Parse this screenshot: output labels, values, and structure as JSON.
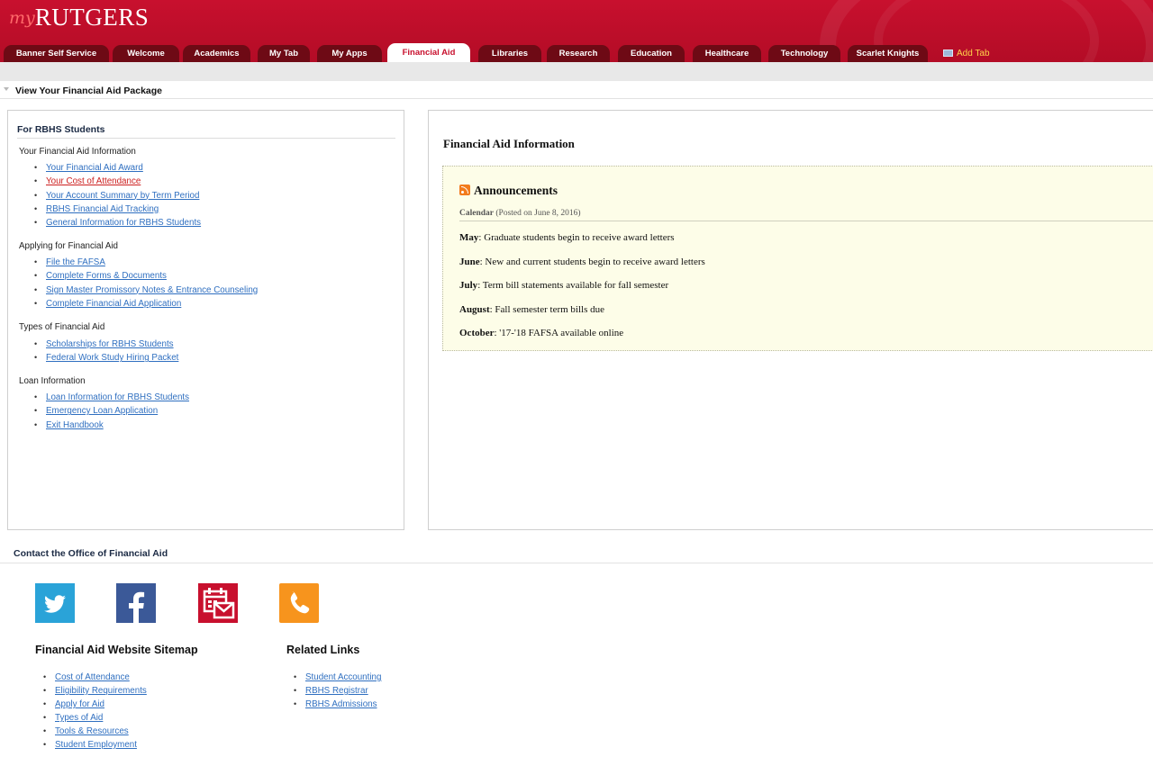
{
  "header": {
    "logo_prefix": "my",
    "logo_main": "RUTGERS",
    "tabs": [
      {
        "label": "Banner Self Service"
      },
      {
        "label": "Welcome"
      },
      {
        "label": "Academics"
      },
      {
        "label": "My Tab"
      },
      {
        "label": "My Apps"
      },
      {
        "label": "Financial Aid"
      },
      {
        "label": "Libraries"
      },
      {
        "label": "Research"
      },
      {
        "label": "Education"
      },
      {
        "label": "Healthcare"
      },
      {
        "label": "Technology"
      },
      {
        "label": "Scarlet Knights"
      }
    ],
    "active_tab": "Financial Aid",
    "add_tab_label": "Add Tab"
  },
  "package": {
    "title": "View Your Financial Aid Package"
  },
  "left_panel": {
    "title": "For RBHS Students",
    "sections": [
      {
        "heading": "Your Financial Aid Information",
        "links": [
          "Your Financial Aid Award",
          "Your Cost of Attendance",
          "Your Account Summary by Term Period",
          "RBHS Financial Aid Tracking",
          "General Information for RBHS Students"
        ]
      },
      {
        "heading": "Applying for Financial Aid",
        "links": [
          "File the FAFSA",
          "Complete Forms & Documents",
          "Sign Master Promissory Notes & Entrance Counseling",
          "Complete Financial Aid Application"
        ]
      },
      {
        "heading": "Types of Financial Aid",
        "links": [
          "Scholarships for RBHS Students",
          "Federal Work Study Hiring Packet"
        ]
      },
      {
        "heading": "Loan Information",
        "links": [
          "Loan Information for RBHS Students",
          "Emergency Loan Application",
          "Exit Handbook"
        ]
      }
    ]
  },
  "right_panel": {
    "title": "Financial Aid Information",
    "announcements": {
      "heading": "Announcements",
      "calendar_label": "Calendar",
      "posted": "(Posted on June 8, 2016)",
      "events": [
        {
          "month": "May",
          "text": ": Graduate students begin to receive award letters"
        },
        {
          "month": "June",
          "text": ": New and current students begin to receive award letters"
        },
        {
          "month": "July",
          "text": ": Term bill statements available for fall semester"
        },
        {
          "month": "August",
          "text": ": Fall semester term bills due"
        },
        {
          "month": "October",
          "text": ": '17-'18 FAFSA available online"
        }
      ]
    }
  },
  "footer": {
    "contact_title": "Contact the Office of Financial Aid",
    "social_icons": [
      "twitter-icon",
      "facebook-icon",
      "calendar-mail-icon",
      "phone-icon"
    ],
    "icon_colors": {
      "twitter": "#2aa3d8",
      "facebook": "#3b5998",
      "calendar": "#c8102e",
      "phone": "#f7941d"
    },
    "sitemap": {
      "heading": "Financial Aid Website Sitemap",
      "links": [
        "Cost of Attendance",
        "Eligibility Requirements",
        "Apply for Aid",
        "Types of Aid",
        "Tools & Resources",
        "Student Employment"
      ]
    },
    "related": {
      "heading": "Related Links",
      "links": [
        "Student Accounting",
        "RBHS Registrar",
        "RBHS Admissions"
      ]
    }
  },
  "colors": {
    "brand_red": "#c8102e",
    "tab_dark": "#6e0a15",
    "link_blue": "#2f6fc0",
    "visited_red": "#cc1f1f",
    "announcement_bg": "#fdfde8"
  }
}
